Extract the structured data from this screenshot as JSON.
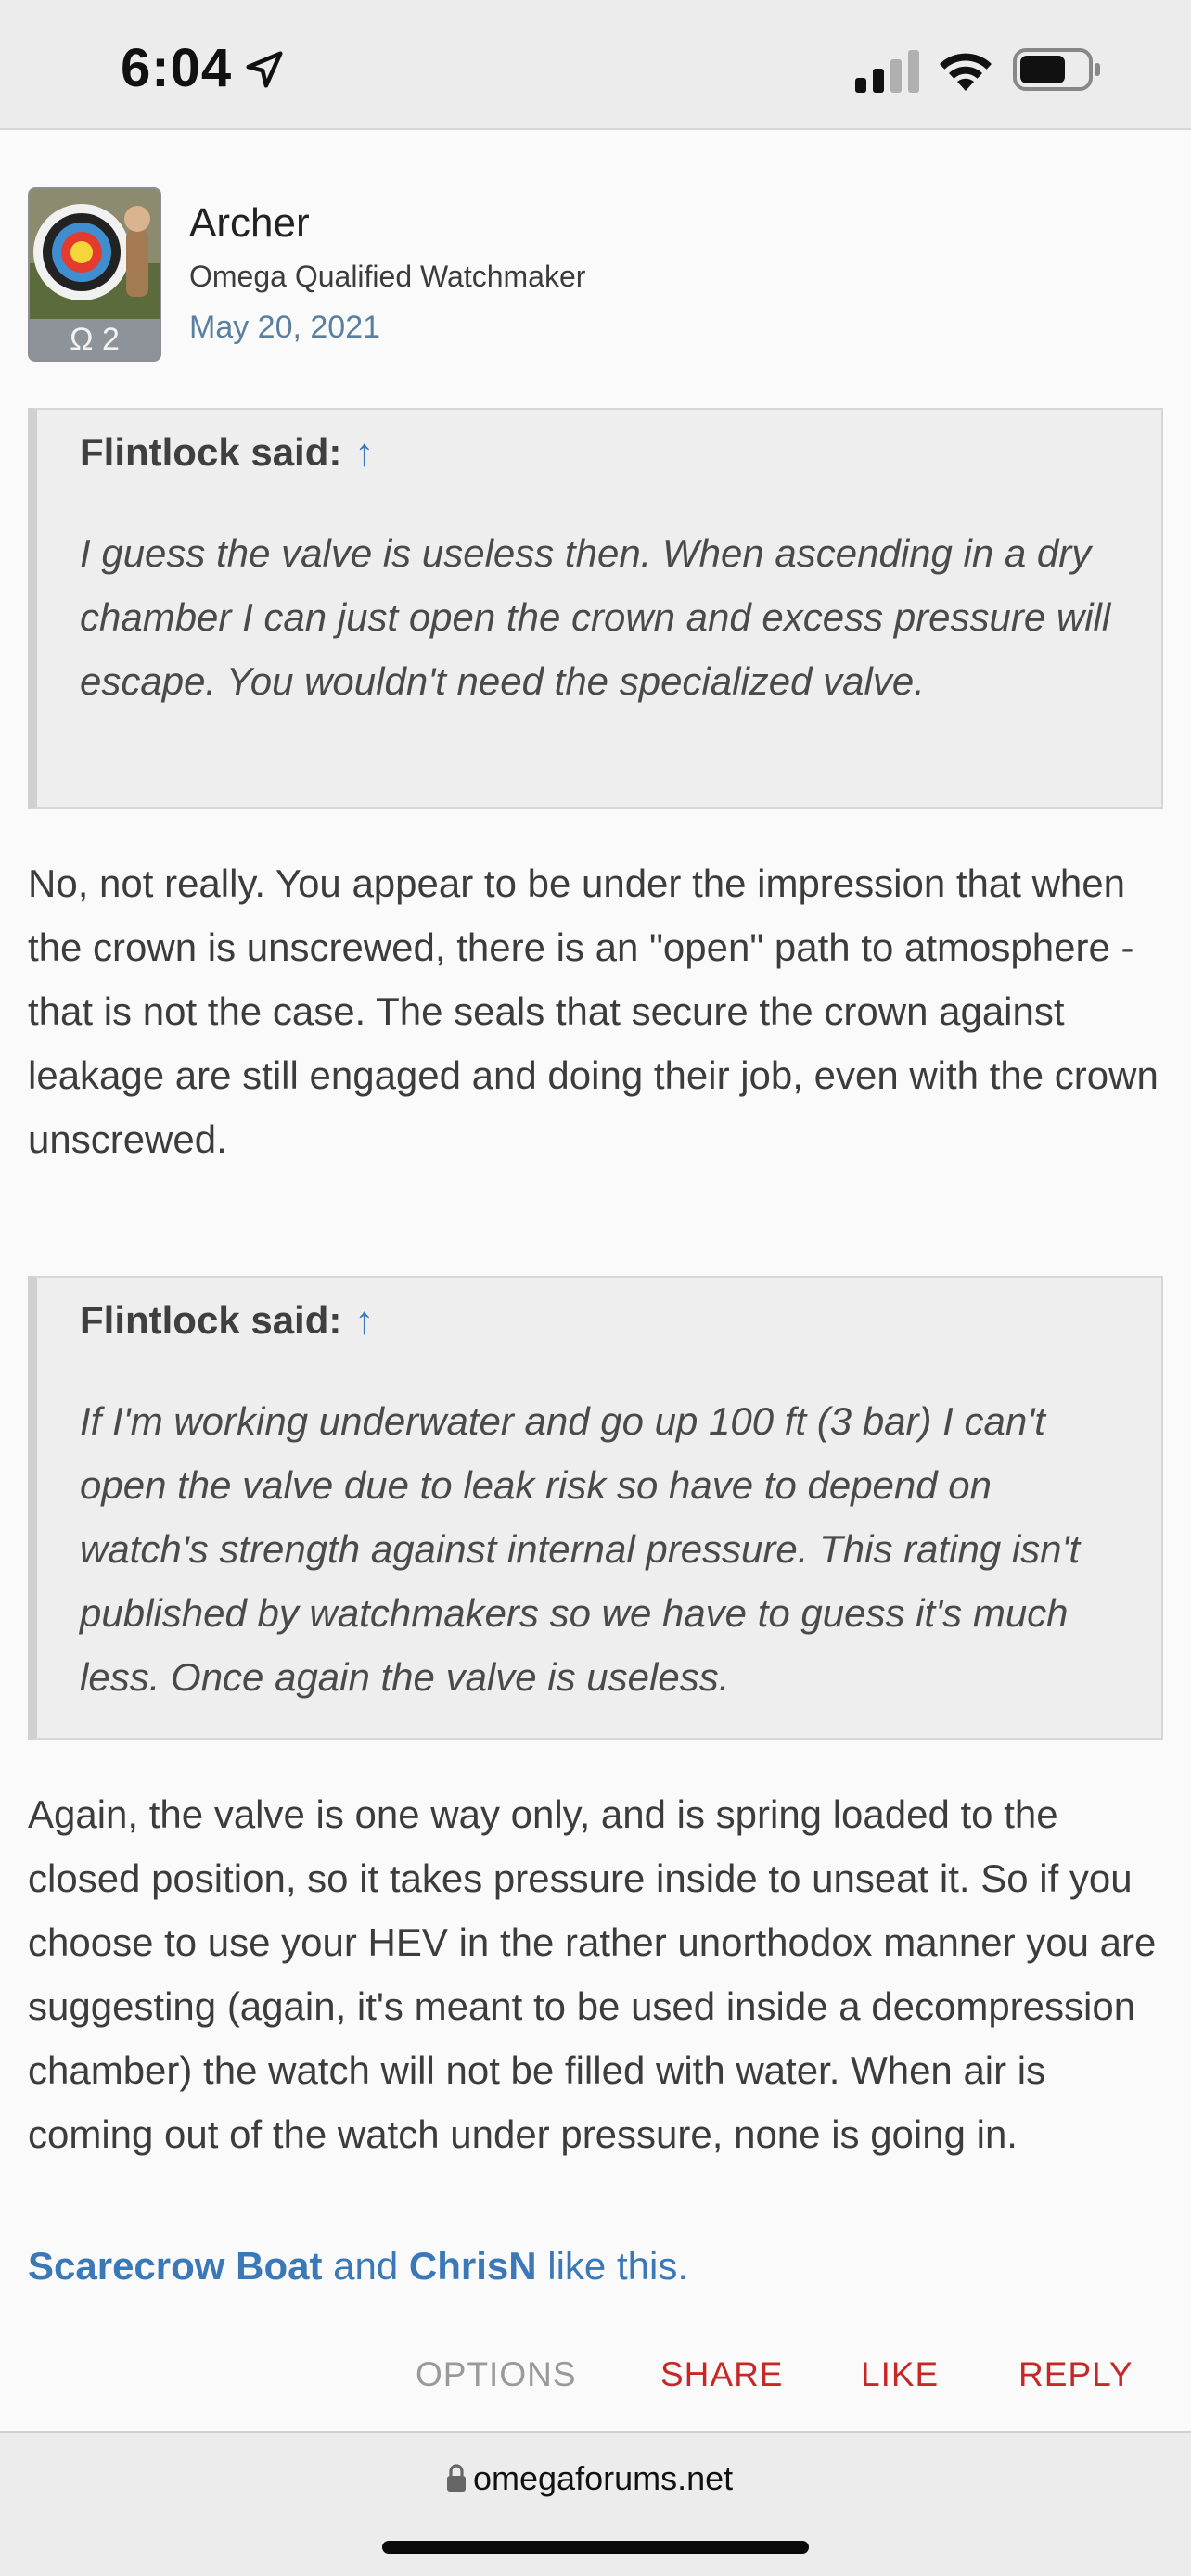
{
  "status_bar": {
    "time": "6:04"
  },
  "post": {
    "author": {
      "name": "Archer",
      "title": "Omega Qualified Watchmaker",
      "badge": "Ω 2"
    },
    "date": "May 20, 2021",
    "quotes": [
      {
        "head": "Flintlock said:",
        "arrow": "↑",
        "text": "I guess the valve is useless then. When ascending in a dry chamber I can just open the crown and excess pressure will escape. You wouldn't need the specialized valve."
      },
      {
        "head": "Flintlock said:",
        "arrow": "↑",
        "text": "If I'm working underwater and go up 100 ft (3 bar) I can't open the valve due to leak risk so have to depend on watch's strength against internal pressure. This rating isn't published by watchmakers so we have to guess it's much less. Once again the valve is useless."
      }
    ],
    "paragraphs": [
      "No, not really. You appear to be under the impression that when the crown is unscrewed, there is an \"open\" path to atmosphere - that is not the case. The seals that secure the crown against leakage are still engaged and doing their job, even with the crown unscrewed.",
      "Again, the valve is one way only, and is spring loaded to the closed position, so it takes pressure inside to unseat it. So if you choose to use your HEV in the rather unorthodox manner you are suggesting (again, it's meant to be used inside a decompression chamber) the watch will not be filled with water. When air is coming out of the watch under pressure, none is going in."
    ],
    "likes": {
      "user1": "Scarecrow Boat",
      "joiner": "and",
      "user2": "ChrisN",
      "suffix": "like this."
    },
    "actions": {
      "options": "OPTIONS",
      "share": "SHARE",
      "like": "LIKE",
      "reply": "REPLY"
    }
  },
  "browser": {
    "url": "omegaforums.net"
  },
  "colors": {
    "link": "#3a78b8",
    "action_red": "#c62828",
    "date": "#5a7fa0",
    "quote_bg": "#eeeeee"
  }
}
